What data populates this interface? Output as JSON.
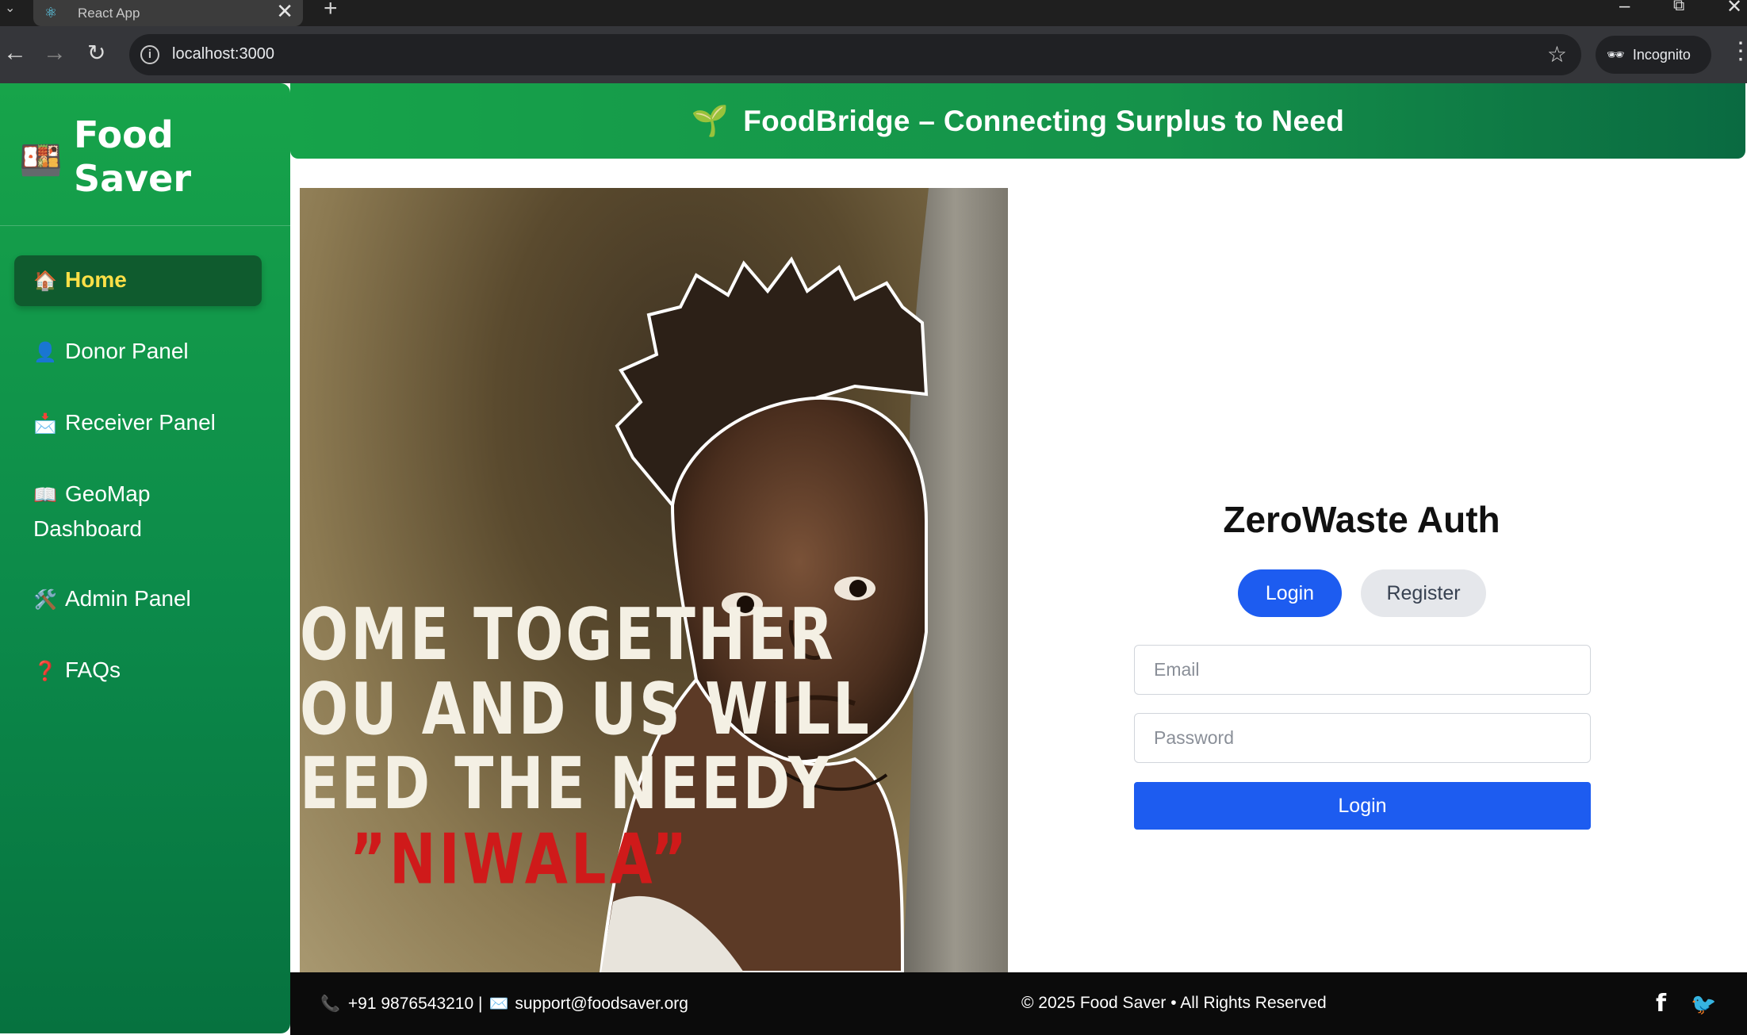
{
  "browser": {
    "tab_title": "React App",
    "tab_close": "✕",
    "new_tab": "+",
    "url": "localhost:3000",
    "incognito_label": "Incognito",
    "icons": [
      "react-icon",
      "back-icon",
      "forward-icon",
      "reload-icon",
      "site-info-icon",
      "bookmark-star-icon",
      "incognito-icon",
      "more-menu-icon",
      "minimize-icon",
      "restore-icon",
      "close-window-icon"
    ]
  },
  "sidebar": {
    "brand": "Food Saver",
    "items": [
      {
        "icon": "🏠",
        "label": "Home",
        "active": true
      },
      {
        "icon": "👤",
        "label": "Donor Panel",
        "active": false
      },
      {
        "icon": "📩",
        "label": "Receiver Panel",
        "active": false
      },
      {
        "icon": "📖",
        "label": "GeoMap Dashboard",
        "active": false
      },
      {
        "icon": "🛠️",
        "label": "Admin Panel",
        "active": false
      },
      {
        "icon": "❓",
        "label": "FAQs",
        "active": false
      }
    ]
  },
  "header": {
    "icon": "🌱",
    "title": "FoodBridge – Connecting Surplus to Need"
  },
  "poster": {
    "lines": [
      "OME TOGETHER",
      "OU AND US WILL",
      "EED THE NEEDY"
    ],
    "highlight": "”NIWALA”"
  },
  "auth": {
    "title": "ZeroWaste Auth",
    "tabs": {
      "login": "Login",
      "register": "Register"
    },
    "email_placeholder": "Email",
    "password_placeholder": "Password",
    "submit_label": "Login"
  },
  "footer": {
    "phone": "+91 9876543210 |",
    "email": "support@foodsaver.org",
    "copyright": "© 2025 Food Saver • All Rights Reserved",
    "social": {
      "facebook": "f",
      "twitter": "🐦"
    }
  },
  "colors": {
    "sidebar_green": "#16a34a",
    "active_nav_bg": "#0f5b2e",
    "active_nav_text": "#fde047",
    "primary_blue": "#1d5cf0",
    "footer_bg": "#0b0b0b"
  }
}
